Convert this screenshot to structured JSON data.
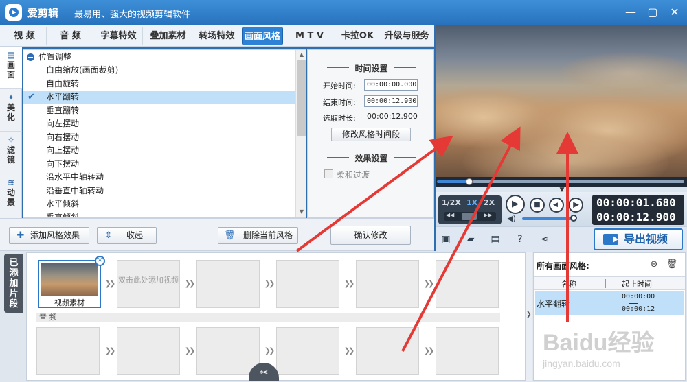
{
  "app": {
    "title": "爱剪辑",
    "slogan": "最易用、强大的视频剪辑软件",
    "window_buttons": [
      "—",
      "▢",
      "✕"
    ]
  },
  "tabs": [
    {
      "label": "视 频",
      "active": false
    },
    {
      "label": "音 频",
      "active": false
    },
    {
      "label": "字幕特效",
      "active": false
    },
    {
      "label": "叠加素材",
      "active": false
    },
    {
      "label": "转场特效",
      "active": false
    },
    {
      "label": "画面风格",
      "active": true
    },
    {
      "label": "M T V",
      "active": false
    },
    {
      "label": "卡拉OK",
      "active": false
    },
    {
      "label": "升级与服务",
      "active": false
    }
  ],
  "side_tabs": [
    {
      "label": "画面",
      "icon": "image-icon",
      "active": true
    },
    {
      "label": "美化",
      "icon": "magic-wand-icon",
      "active": false
    },
    {
      "label": "滤镜",
      "icon": "sparkle-wand-icon",
      "active": false
    },
    {
      "label": "动景",
      "icon": "wave-icon",
      "active": false
    }
  ],
  "effect_list": {
    "group": "位置调整",
    "items": [
      {
        "label": "自由缩放(画面裁剪)",
        "selected": false
      },
      {
        "label": "自由旋转",
        "selected": false
      },
      {
        "label": "水平翻转",
        "selected": true
      },
      {
        "label": "垂直翻转",
        "selected": false
      },
      {
        "label": "向左摆动",
        "selected": false
      },
      {
        "label": "向右摆动",
        "selected": false
      },
      {
        "label": "向上摆动",
        "selected": false
      },
      {
        "label": "向下摆动",
        "selected": false
      },
      {
        "label": "沿水平中轴转动",
        "selected": false
      },
      {
        "label": "沿垂直中轴转动",
        "selected": false
      },
      {
        "label": "水平倾斜",
        "selected": false
      },
      {
        "label": "垂直倾斜",
        "selected": false
      }
    ]
  },
  "time_settings": {
    "title": "时间设置",
    "start_label": "开始时间:",
    "start_value": "00:00:00.000",
    "end_label": "结束时间:",
    "end_value": "00:00:12.900",
    "duration_label": "选取时长:",
    "duration_value": "00:00:12.900",
    "modify_button": "修改风格时间段"
  },
  "effect_settings": {
    "title": "效果设置",
    "smooth_label": "柔和过渡",
    "smooth_checked": false
  },
  "actions": {
    "add": "添加风格效果",
    "collapse": "收起",
    "delete": "删除当前风格",
    "confirm": "确认修改"
  },
  "player": {
    "progress": 0.13,
    "speeds": [
      "1/2X",
      "1X",
      "2X"
    ],
    "active_speed": "1X",
    "current_time": "00:00:01.680",
    "total_time": "00:00:12.900",
    "volume": 0.9,
    "export_label": "导出视频"
  },
  "timeline": {
    "added_label": "已添加片段",
    "clip_label": "视频素材",
    "hint": "双击此处添加视频",
    "audio_label": "音 频"
  },
  "styles_panel": {
    "title": "所有画面风格:",
    "col_name": "名称",
    "col_time": "起止时间",
    "rows": [
      {
        "name": "水平翻转",
        "start": "00:00:00",
        "end": "00:00:12"
      }
    ]
  },
  "watermark": {
    "main": "Baidu经验",
    "sub": "jingyan.baidu.com"
  },
  "colors": {
    "accent": "#2d82d6",
    "annotation": "#e53935",
    "selection": "#bfe0f8"
  }
}
